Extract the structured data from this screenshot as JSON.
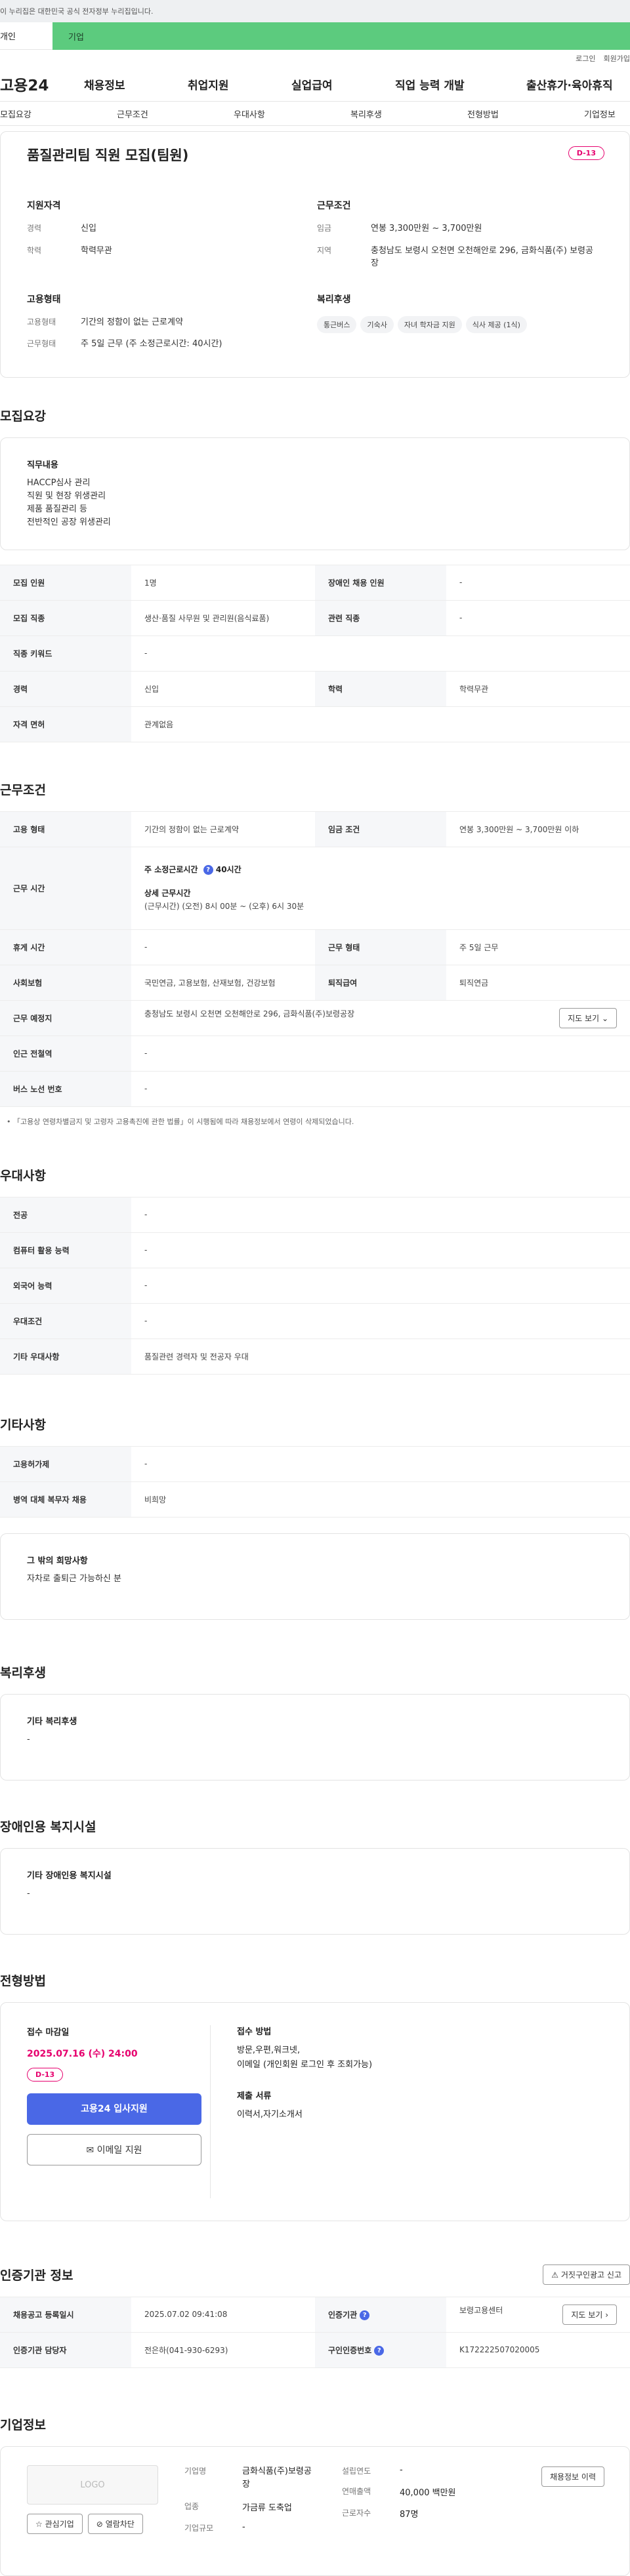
{
  "gov_banner": "이 누리집은 대한민국 공식 전자정부 누리집입니다.",
  "tabs": {
    "individual": "개인",
    "company": "기업"
  },
  "utility": {
    "login": "로그인",
    "join": "회원가입"
  },
  "gnb": {
    "logo": "고용24",
    "menu": [
      "채용정보",
      "취업지원",
      "실업급여",
      "직업 능력 개발",
      "출산휴가·육아휴직"
    ]
  },
  "subnav": [
    "모집요강",
    "근무조건",
    "우대사항",
    "복리후생",
    "전형방법",
    "기업정보"
  ],
  "summary": {
    "title": "품질관리팀 직원 모집(팀원)",
    "dday": "D-13",
    "qual_heading": "지원자격",
    "career_label": "경력",
    "career_value": "신입",
    "edu_label": "학력",
    "edu_value": "학력무관",
    "cond_heading": "근무조건",
    "wage_label": "임금",
    "wage_value": "연봉 3,300만원 ~ 3,700만원",
    "area_label": "지역",
    "area_value": "충청남도 보령시 오천면 오천해안로 296, 금화식품(주) 보령공장",
    "emp_heading": "고용형태",
    "emptype_label": "고용형태",
    "emptype_value": "기간의 정함이 없는 근로계약",
    "worktype_label": "근무형태",
    "worktype_value": "주 5일 근무 (주 소정근로시간: 40시간)",
    "welfare_heading": "복리후생",
    "welfare_chips": [
      "통근버스",
      "기숙사",
      "자녀 학자금 지원",
      "식사 제공 (1식)"
    ]
  },
  "recruit": {
    "heading": "모집요강",
    "duty_heading": "직무내용",
    "duty_lines": [
      "HACCP심사 관리",
      "직원 및 현장 위생관리",
      "제품 품질관리 등",
      "전반적인 공장 위생관리"
    ],
    "rows": {
      "headcount_label": "모집 인원",
      "headcount_value": "1명",
      "disabled_label": "장애인 채용 인원",
      "disabled_value": "-",
      "job_label": "모집 직종",
      "job_value": "생산·품질 사무원 및 관리원(음식료품)",
      "related_label": "관련 직종",
      "related_value": "-",
      "keyword_label": "직종 키워드",
      "keyword_value": "-",
      "career_label": "경력",
      "career_value": "신입",
      "edu_label": "학력",
      "edu_value": "학력무관",
      "license_label": "자격 면허",
      "license_value": "관계없음"
    }
  },
  "work": {
    "heading": "근무조건",
    "emp_label": "고용 형태",
    "emp_value": "기간의 정함이 없는 근로계약",
    "wage_label": "임금 조건",
    "wage_value": "연봉 3,300만원 ~ 3,700만원 이하",
    "hours_label": "근무 시간",
    "hours_week_label": "주 소정근로시간",
    "hours_week_value": "40시간",
    "hours_detail_label": "상세 근무시간",
    "hours_detail_value": "(근무시간) (오전) 8시 00분 ~ (오후) 6시 30분",
    "rest_label": "휴게 시간",
    "rest_value": "-",
    "form_label": "근무 형태",
    "form_value": "주 5일 근무",
    "insurance_label": "사회보험",
    "insurance_value": "국민연금, 고용보험, 산재보험, 건강보험",
    "severance_label": "퇴직급여",
    "severance_value": "퇴직연금",
    "place_label": "근무 예정지",
    "place_value": "충청남도 보령시 오천면 오천해안로 296, 금화식품(주)보령공장",
    "map_button": "지도 보기",
    "station_label": "인근 전철역",
    "station_value": "-",
    "bus_label": "버스 노선 번호",
    "bus_value": "-",
    "note": "「고용상 연령차별금지 및 고령자 고용촉진에 관한 법률」이 시행됨에 따라 채용정보에서 연령이 삭제되었습니다."
  },
  "preference": {
    "heading": "우대사항",
    "major_label": "전공",
    "major_value": "-",
    "computer_label": "컴퓨터 활용 능력",
    "computer_value": "-",
    "language_label": "외국어 능력",
    "language_value": "-",
    "pref_label": "우대조건",
    "pref_value": "-",
    "etc_label": "기타 우대사항",
    "etc_value": "품질관련 경력자 및 전공자 우대"
  },
  "other": {
    "heading": "기타사항",
    "insurance_label": "고용허가제",
    "insurance_value": "-",
    "military_label": "병역 대체 복무자 채용",
    "military_value": "비희망",
    "wish_heading": "그 밖의 희망사항",
    "wish_value": "자차로 출퇴근 가능하신 분"
  },
  "welfare": {
    "heading": "복리후생",
    "box_heading": "기타 복리후생",
    "box_value": "-"
  },
  "disabled_fac": {
    "heading": "장애인용 복지시설",
    "box_heading": "기타 장애인용 복지시설",
    "box_value": "-"
  },
  "selection": {
    "heading": "전형방법",
    "deadline_label": "접수 마감일",
    "deadline_value": "2025.07.16 (수) 24:00",
    "dday": "D-13",
    "apply_button": "고용24 입사지원",
    "email_button": "이메일 지원",
    "method_label": "접수 방법",
    "method_lines": [
      "방문,우편,워크넷,",
      "이메일 (개인회원 로그인 후 조회가능)"
    ],
    "docs_label": "제출 서류",
    "docs_value": "이력서,자기소개서"
  },
  "agency": {
    "heading": "인증기관 정보",
    "report_button": "거짓구인광고 신고",
    "reg_label": "채용공고 등록일시",
    "reg_value": "2025.07.02 09:41:08",
    "org_label": "인증기관",
    "org_value": "보령고용센터",
    "detail_button": "지도 보기",
    "manager_label": "인증기관 담당자",
    "manager_value": "전은하(041-930-6293)",
    "num_label": "구인인증번호",
    "num_value": "K172222507020005"
  },
  "company": {
    "heading": "기업정보",
    "logo": "LOGO",
    "fav_button": "관심기업",
    "block_button": "열람차단",
    "name_label": "기업명",
    "name_value": "금화식품(주)보령공장",
    "founded_label": "설립연도",
    "founded_value": "-",
    "industry_label": "업종",
    "industry_value": "가금류 도축업",
    "sales_label": "연매출액",
    "sales_value": "40,000 백만원",
    "size_label": "기업규모",
    "size_value": "-",
    "employees_label": "근로자수",
    "employees_value": "87명",
    "jobs_button": "채용정보 이력"
  }
}
